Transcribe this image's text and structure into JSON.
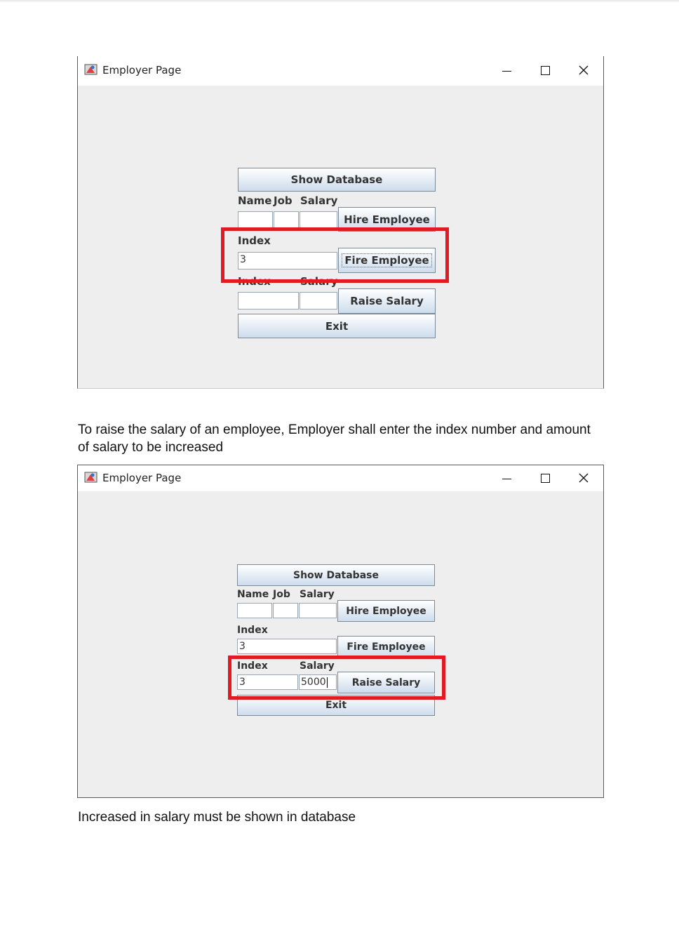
{
  "windows": [
    {
      "title": "Employer Page",
      "show_database": "Show Database",
      "label_name": "Name",
      "label_job": "Job",
      "label_salary": "Salary",
      "hire_button": "Hire Employee",
      "label_index": "Index",
      "fire_index_value": "3",
      "fire_button": "Fire Employee",
      "raise_label_index": "Index",
      "raise_label_salary": "Salary",
      "raise_index_value": "",
      "raise_salary_value": "",
      "raise_button": "Raise Salary",
      "exit_button": "Exit"
    },
    {
      "title": "Employer Page",
      "show_database": "Show Database",
      "label_name": "Name",
      "label_job": "Job",
      "label_salary": "Salary",
      "hire_button": "Hire Employee",
      "label_index": "Index",
      "fire_index_value": "3",
      "fire_button": "Fire Employee",
      "raise_label_index": "Index",
      "raise_label_salary": "Salary",
      "raise_index_value": "3",
      "raise_salary_value": "5000",
      "raise_button": "Raise Salary",
      "exit_button": "Exit"
    }
  ],
  "captions": {
    "raise_instructions": "To raise the salary of an employee, Employer shall enter the index number and amount of salary to be increased",
    "result_note": "Increased in salary must be shown in database"
  },
  "highlight_color": "#e01b24"
}
